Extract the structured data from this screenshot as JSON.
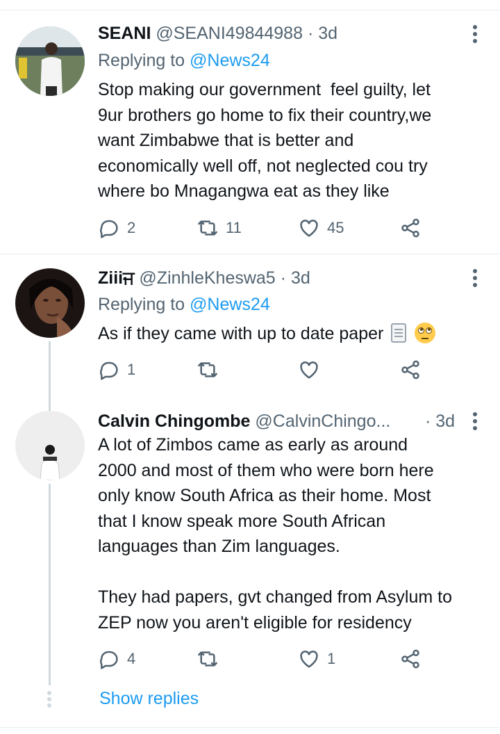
{
  "tweets": [
    {
      "name": "SEANI",
      "handle": "@SEANI49844988",
      "time": "3d",
      "replying_prefix": "Replying to ",
      "replying_to": "@News24",
      "text": "Stop making our government  feel guilty, let\n9ur brothers go home to fix their country,we\nwant Zimbabwe that is better and\neconomically well off, not neglected cou try\nwhere bo Mnagangwa eat as they like",
      "replies": "2",
      "retweets": "11",
      "likes": "45"
    },
    {
      "name": "Ziiiਜ",
      "handle": "@ZinhleKheswa5",
      "time": "3d",
      "replying_prefix": "Replying to ",
      "replying_to": "@News24",
      "text": "As if they came with up to date paper",
      "emojis": [
        "page-facing-up-emoji",
        "face-with-rolling-eyes-emoji"
      ],
      "replies": "1",
      "retweets": "",
      "likes": ""
    },
    {
      "name": "Calvin Chingombe",
      "handle": "@CalvinChingo...",
      "time": "3d",
      "text": "A lot of Zimbos came as early as around\n2000 and most of them who were born here\nonly know South Africa as their home. Most\nthat I know speak more South African\nlanguages than Zim languages.\n\nThey had papers, gvt changed from Asylum to\nZEP now you aren't eligible for residency",
      "replies": "4",
      "retweets": "",
      "likes": "1"
    }
  ],
  "separator": " · ",
  "show_replies": "Show replies",
  "colors": {
    "accent": "#1d9bf0",
    "secondary_text": "#536471",
    "thread_line": "#cfd9de"
  }
}
